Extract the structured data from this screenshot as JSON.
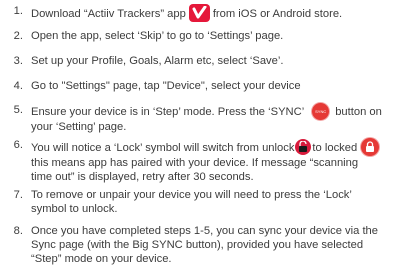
{
  "steps": [
    {
      "number": "1.",
      "lines": [
        {
          "a": "Download “Actiiv Trackers” app",
          "icon": "actiiv-app-icon",
          "b": "from iOS or Android store."
        }
      ]
    },
    {
      "number": "2.",
      "lines": [
        {
          "a": "Open the app, select ‘Skip’ to go to ‘Settings’ page."
        }
      ]
    },
    {
      "number": "3.",
      "lines": [
        {
          "a": "Set up your Profile, Goals, Alarm etc, select ‘Save’."
        }
      ]
    },
    {
      "number": "4.",
      "lines": [
        {
          "a": "Go to \"Settings\" page, tap \"Device\", select your device"
        }
      ]
    },
    {
      "number": "5.",
      "lines": [
        {
          "a": "Ensure your device is in ‘Step’ mode. Press the ‘SYNC’",
          "icon": "sync-button-icon",
          "b": "button on"
        },
        {
          "a": "your ‘Setting’ page."
        }
      ]
    },
    {
      "number": "6.",
      "lines": [
        {
          "a": "You will notice a ‘Lock’ symbol will switch from unlock",
          "icon": "unlock-icon",
          "b": "to locked",
          "icon2": "locked-icon"
        },
        {
          "a": "this means app has paired with your device. If message “scanning"
        },
        {
          "a": "time out” is displayed, retry after 30 seconds."
        }
      ]
    },
    {
      "number": "7.",
      "lines": [
        {
          "a": "To remove or unpair your device you will need to press the ‘Lock’"
        },
        {
          "a": "symbol to unlock."
        }
      ]
    },
    {
      "number": "8.",
      "lines": [
        {
          "a": "Once you have completed steps 1-5, you can sync your device via the"
        },
        {
          "a": "Sync page (with the Big SYNC button), provided you have selected"
        },
        {
          "a": "“Step” mode on your device."
        }
      ]
    }
  ],
  "icons": {
    "sync_label": "SYNC",
    "accent": "#e5183a"
  }
}
